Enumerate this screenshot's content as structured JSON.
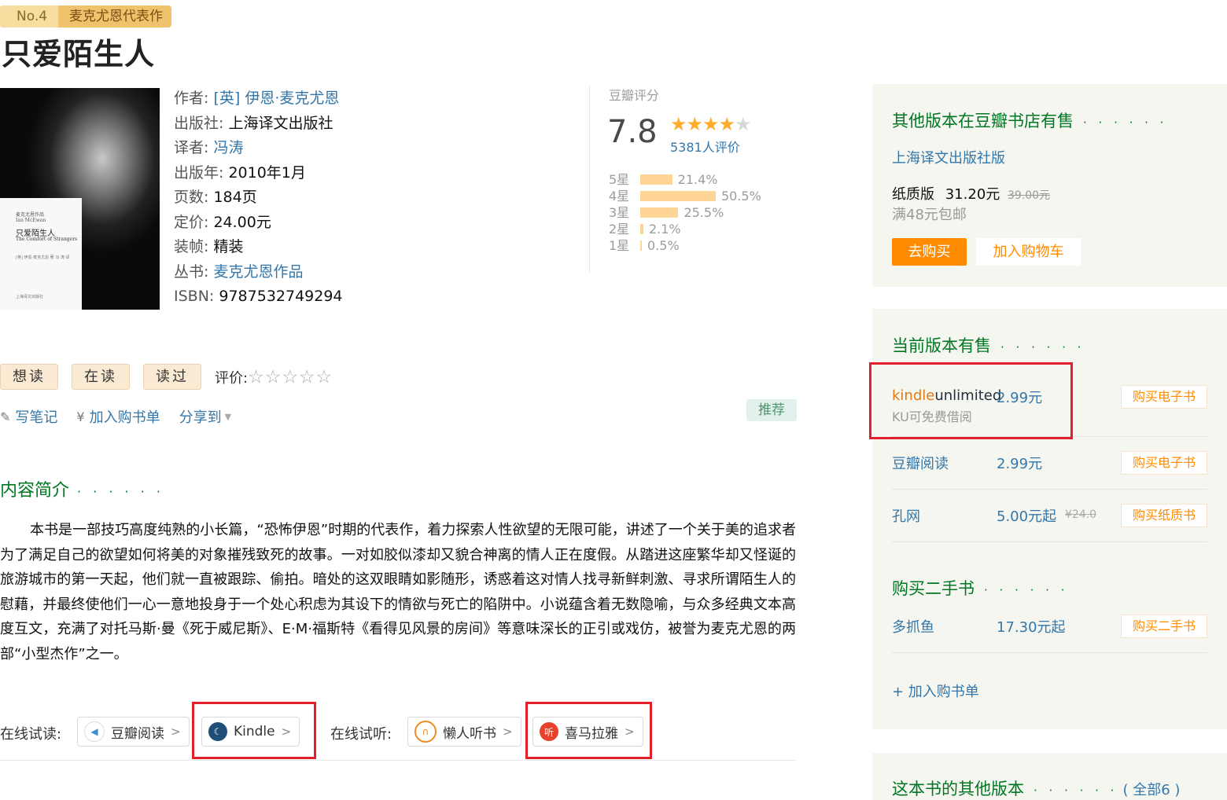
{
  "header": {
    "rank": "No.4",
    "rank_tag": "麦克尤恩代表作",
    "title": "只爱陌生人"
  },
  "cover": {
    "lines": [
      "麦克尤恩作品",
      "Ian McEwan",
      "只爱陌生人",
      "The Comfort of Strangers",
      "[英] 伊恩·麦克尤恩 著  冯 涛 译",
      "上海译文出版社"
    ]
  },
  "info": {
    "author_key": "作者:",
    "author_val": "[英] 伊恩·麦克尤恩",
    "publisher_key": "出版社:",
    "publisher_val": "上海译文出版社",
    "translator_key": "译者:",
    "translator_val": "冯涛",
    "year_key": "出版年:",
    "year_val": "2010年1月",
    "pages_key": "页数:",
    "pages_val": "184页",
    "price_key": "定价:",
    "price_val": "24.00元",
    "binding_key": "装帧:",
    "binding_val": "精装",
    "series_key": "丛书:",
    "series_val": "麦克尤恩作品",
    "isbn_key": "ISBN:",
    "isbn_val": "9787532749294"
  },
  "rating": {
    "label": "豆瓣评分",
    "score": "7.8",
    "stars_filled": 4,
    "count": "5381人评价",
    "rows": [
      {
        "level": "5星",
        "pct": "21.4%",
        "value": 21.4
      },
      {
        "level": "4星",
        "pct": "50.5%",
        "value": 50.5
      },
      {
        "level": "3星",
        "pct": "25.5%",
        "value": 25.5
      },
      {
        "level": "2星",
        "pct": "2.1%",
        "value": 2.1
      },
      {
        "level": "1星",
        "pct": "0.5%",
        "value": 0.5
      }
    ]
  },
  "actions": {
    "want": "想读",
    "reading": "在读",
    "read": "读过",
    "rate_label": "评价:",
    "write_note": "写笔记",
    "add_cart": "加入购书单",
    "share": "分享到",
    "recommend": "推荐"
  },
  "intro": {
    "heading": "内容简介",
    "dots": "· · · · · ·",
    "text": "本书是一部技巧高度纯熟的小长篇，“恐怖伊恩”时期的代表作，着力探索人性欲望的无限可能，讲述了一个关于美的追求者为了满足自己的欲望如何将美的对象摧残致死的故事。一对如胶似漆却又貌合神离的情人正在度假。从踏进这座繁华却又怪诞的旅游城市的第一天起，他们就一直被跟踪、偷拍。暗处的这双眼睛如影随形，诱惑着这对情人找寻新鲜刺激、寻求所谓陌生人的慰藉，并最终使他们一心一意地投身于一个处心积虑为其设下的情欲与死亡的陷阱中。小说蕴含着无数隐喻，与众多经典文本高度互文，充满了对托马斯·曼《死于威尼斯》、E·M·福斯特《看得见风景的房间》等意味深长的正引或戏仿，被誉为麦克尤恩的两部“小型杰作”之一。"
  },
  "try": {
    "read_label": "在线试读:",
    "douban_read": "豆瓣阅读",
    "kindle": "Kindle",
    "listen_label": "在线试听:",
    "lanren": "懒人听书",
    "ximalaya": "喜马拉雅",
    "arrow": ">"
  },
  "sidebar": {
    "other_heading": "其他版本在豆瓣书店有售",
    "dots": "· · · · · ·",
    "edition": "上海译文出版社版",
    "paper_label": "纸质版",
    "paper_price": "31.20元",
    "paper_orig": "39.00元",
    "free_ship": "满48元包邮",
    "buy": "去购买",
    "add_cart": "加入购物车",
    "current_heading": "当前版本有售",
    "kindle_word1": "kindle",
    "kindle_word2": "unlimited",
    "ku_note": "KU可免费借阅",
    "ku_price": "2.99元",
    "buy_ebook": "购买电子书",
    "douban_read": "豆瓣阅读",
    "douban_price": "2.99元",
    "kongwang": "孔网",
    "kong_price": "5.00元起",
    "kong_orig": "¥24.0",
    "buy_paper": "购买纸质书",
    "used_heading": "购买二手书",
    "duozhuayu": "多抓鱼",
    "used_price": "17.30元起",
    "buy_used": "购买二手书",
    "add_list": "+ 加入购书单",
    "other_versions": "这本书的其他版本",
    "all": "( 全部6 )"
  },
  "colors": {
    "link": "#3377aa",
    "green": "#007722",
    "orange": "#ff8c00",
    "star": "#ffac2d",
    "highlight_box": "#e0202b"
  }
}
